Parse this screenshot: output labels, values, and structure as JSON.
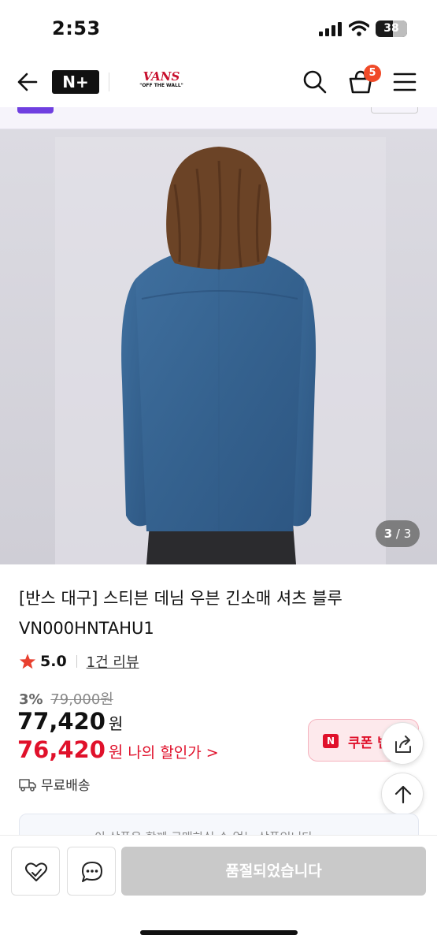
{
  "status_bar": {
    "time": "2:53",
    "battery": "38"
  },
  "header": {
    "logo_text": "N+",
    "brand_name": "VANS",
    "brand_tagline": "\"OFF THE WALL\"",
    "cart_count": "5",
    "icons": [
      "back-arrow-icon",
      "search-icon",
      "cart-icon",
      "menu-icon"
    ]
  },
  "gallery": {
    "current": "3",
    "separator": "/",
    "total": "3"
  },
  "product": {
    "title": "[반스 대구] 스티븐 데님 우븐 긴소매 셔츠 블루 VN000HNTAHU1",
    "rating": "5.0",
    "review_link": "1건 리뷰",
    "discount_percent": "3%",
    "original_price": "79,000원",
    "price": "77,420",
    "price_unit": "원",
    "my_price": "76,420",
    "my_price_unit": "원",
    "my_price_link": "나의 할인가 >",
    "coupon_label": "쿠폰 받",
    "shipping": "무료배송",
    "notice": "이 상품은 함께 구매하실 수 없는 상품입니다"
  },
  "bottom_bar": {
    "soldout_label": "품절되었습니다"
  },
  "colors": {
    "accent_red": "#e0112b",
    "badge_orange": "#f04a28",
    "promo_purple": "#6f3fe0",
    "disabled_gray": "#c9c9c9"
  }
}
